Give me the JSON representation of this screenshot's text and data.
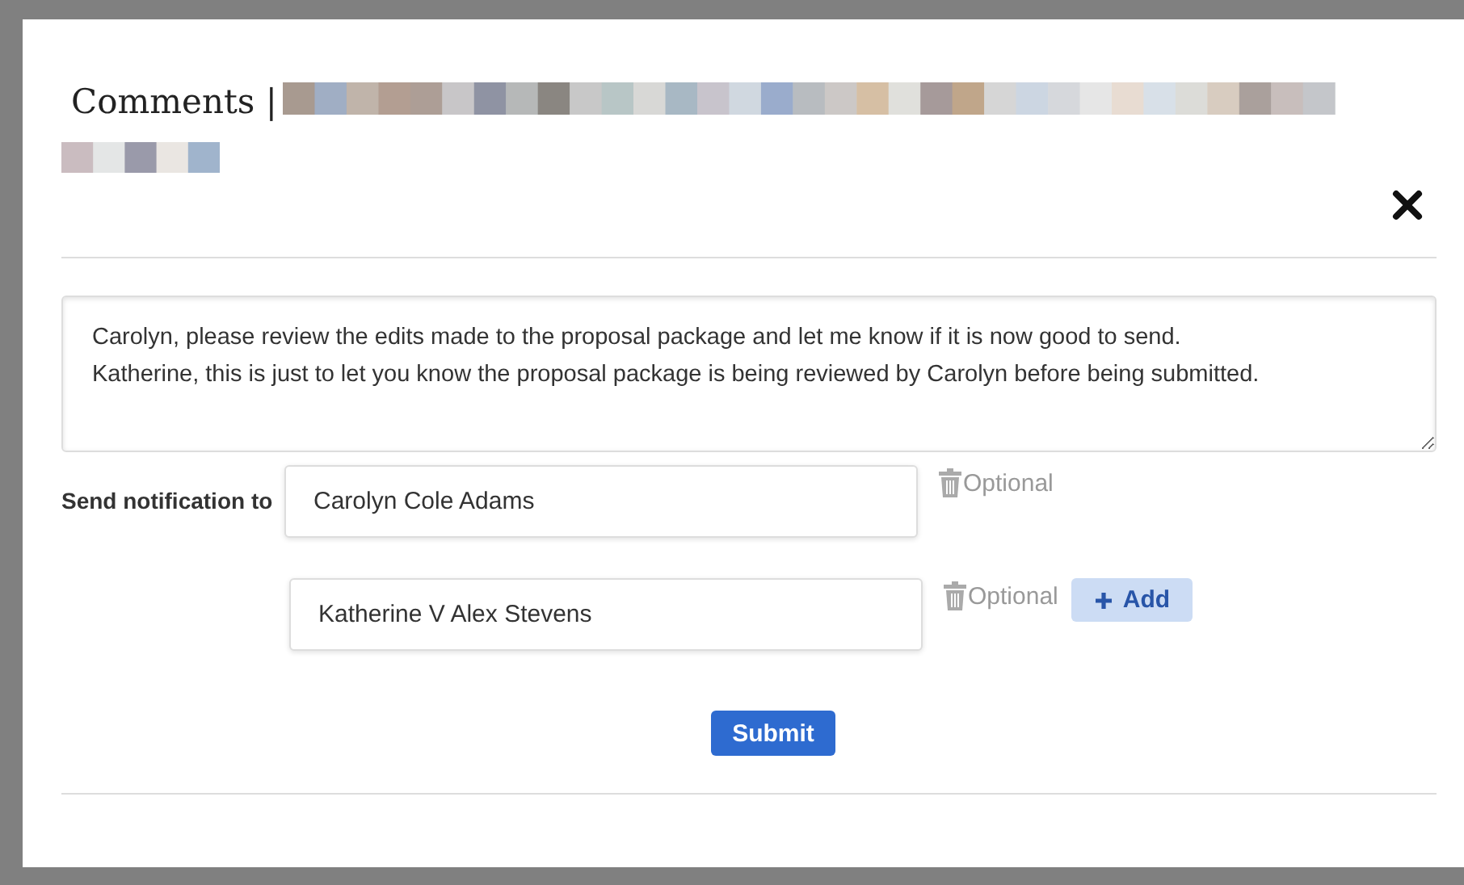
{
  "dialog": {
    "title": "Comments |",
    "comment": {
      "value": "Carolyn, please review the edits made to the proposal package and let me know if it is now good to send.\nKatherine, this is just to let you know the proposal package is being reviewed by Carolyn before being submitted."
    },
    "notify_label": "Send notification to",
    "recipients": [
      {
        "value": "Carolyn Cole Adams",
        "hint": "Optional"
      },
      {
        "value": "Katherine V Alex Stevens",
        "hint": "Optional"
      }
    ],
    "add_button": "Add",
    "submit_button": "Submit"
  }
}
